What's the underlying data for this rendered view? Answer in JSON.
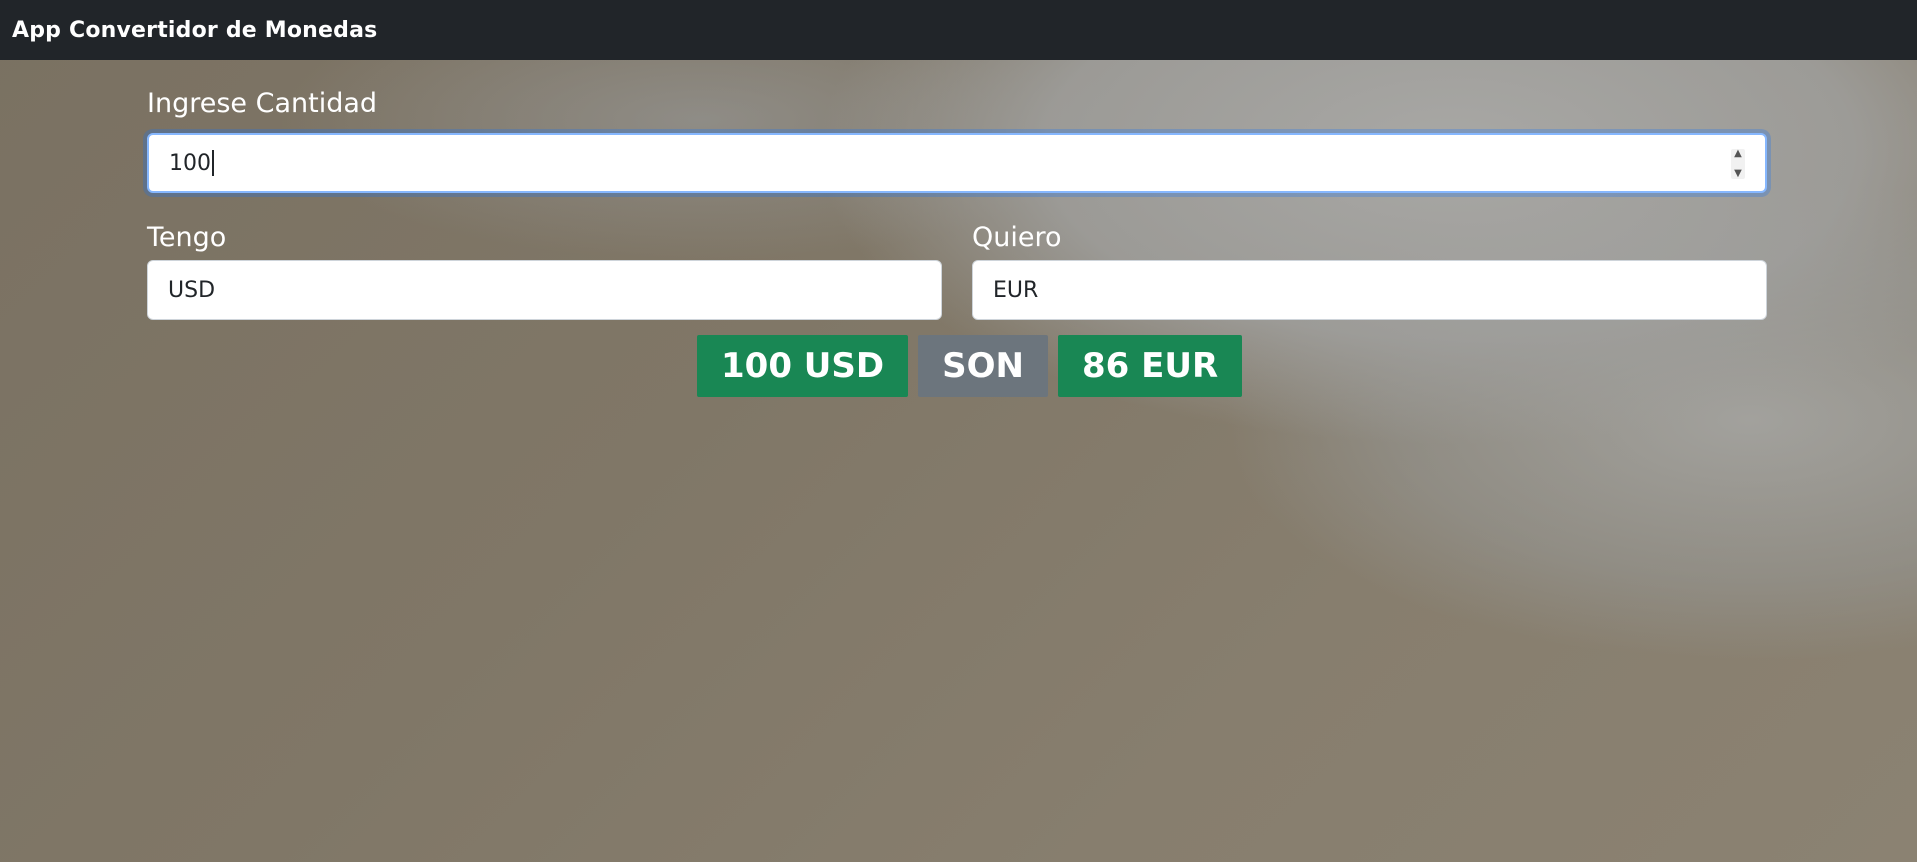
{
  "navbar": {
    "title": "App Convertidor de Monedas"
  },
  "form": {
    "amount_label": "Ingrese Cantidad",
    "amount_value": "100",
    "have_label": "Tengo",
    "have_value": "USD",
    "want_label": "Quiero",
    "want_value": "EUR"
  },
  "result": {
    "from": "100 USD",
    "connector": "SON",
    "to": "86 EUR"
  },
  "colors": {
    "navbar": "#212529",
    "success": "#198754",
    "secondary": "#6c757d",
    "focus_border": "#86b7fe"
  }
}
